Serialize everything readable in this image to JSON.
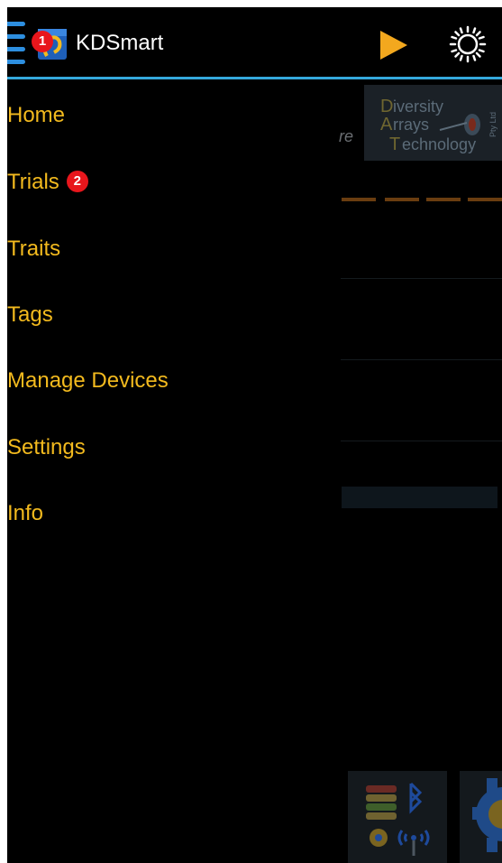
{
  "app": {
    "title": "KDSmart"
  },
  "badges": {
    "first": "1",
    "second": "2"
  },
  "nav": {
    "items": [
      {
        "label": "Home"
      },
      {
        "label": "Trials"
      },
      {
        "label": "Traits"
      },
      {
        "label": "Tags"
      },
      {
        "label": "Manage Devices"
      },
      {
        "label": "Settings"
      },
      {
        "label": "Info"
      }
    ]
  },
  "background": {
    "partial_text": "re",
    "logo": {
      "line1": "Diversity",
      "line2": "Arrays",
      "line3": "Technology",
      "suffix": "Pty Ltd"
    }
  },
  "icons": {
    "drawer_toggle": "drawer-toggle-icon",
    "app": "kdsmart-app-icon",
    "play": "play-icon",
    "brightness": "brightness-icon",
    "database": "database-icon",
    "bluetooth": "bluetooth-icon",
    "gear": "gear-icon",
    "wireless": "wireless-icon"
  },
  "colors": {
    "accent": "#f3ba1e",
    "actionbar_divider": "#35a9dc",
    "badge": "#e8161c",
    "background": "#000000"
  }
}
